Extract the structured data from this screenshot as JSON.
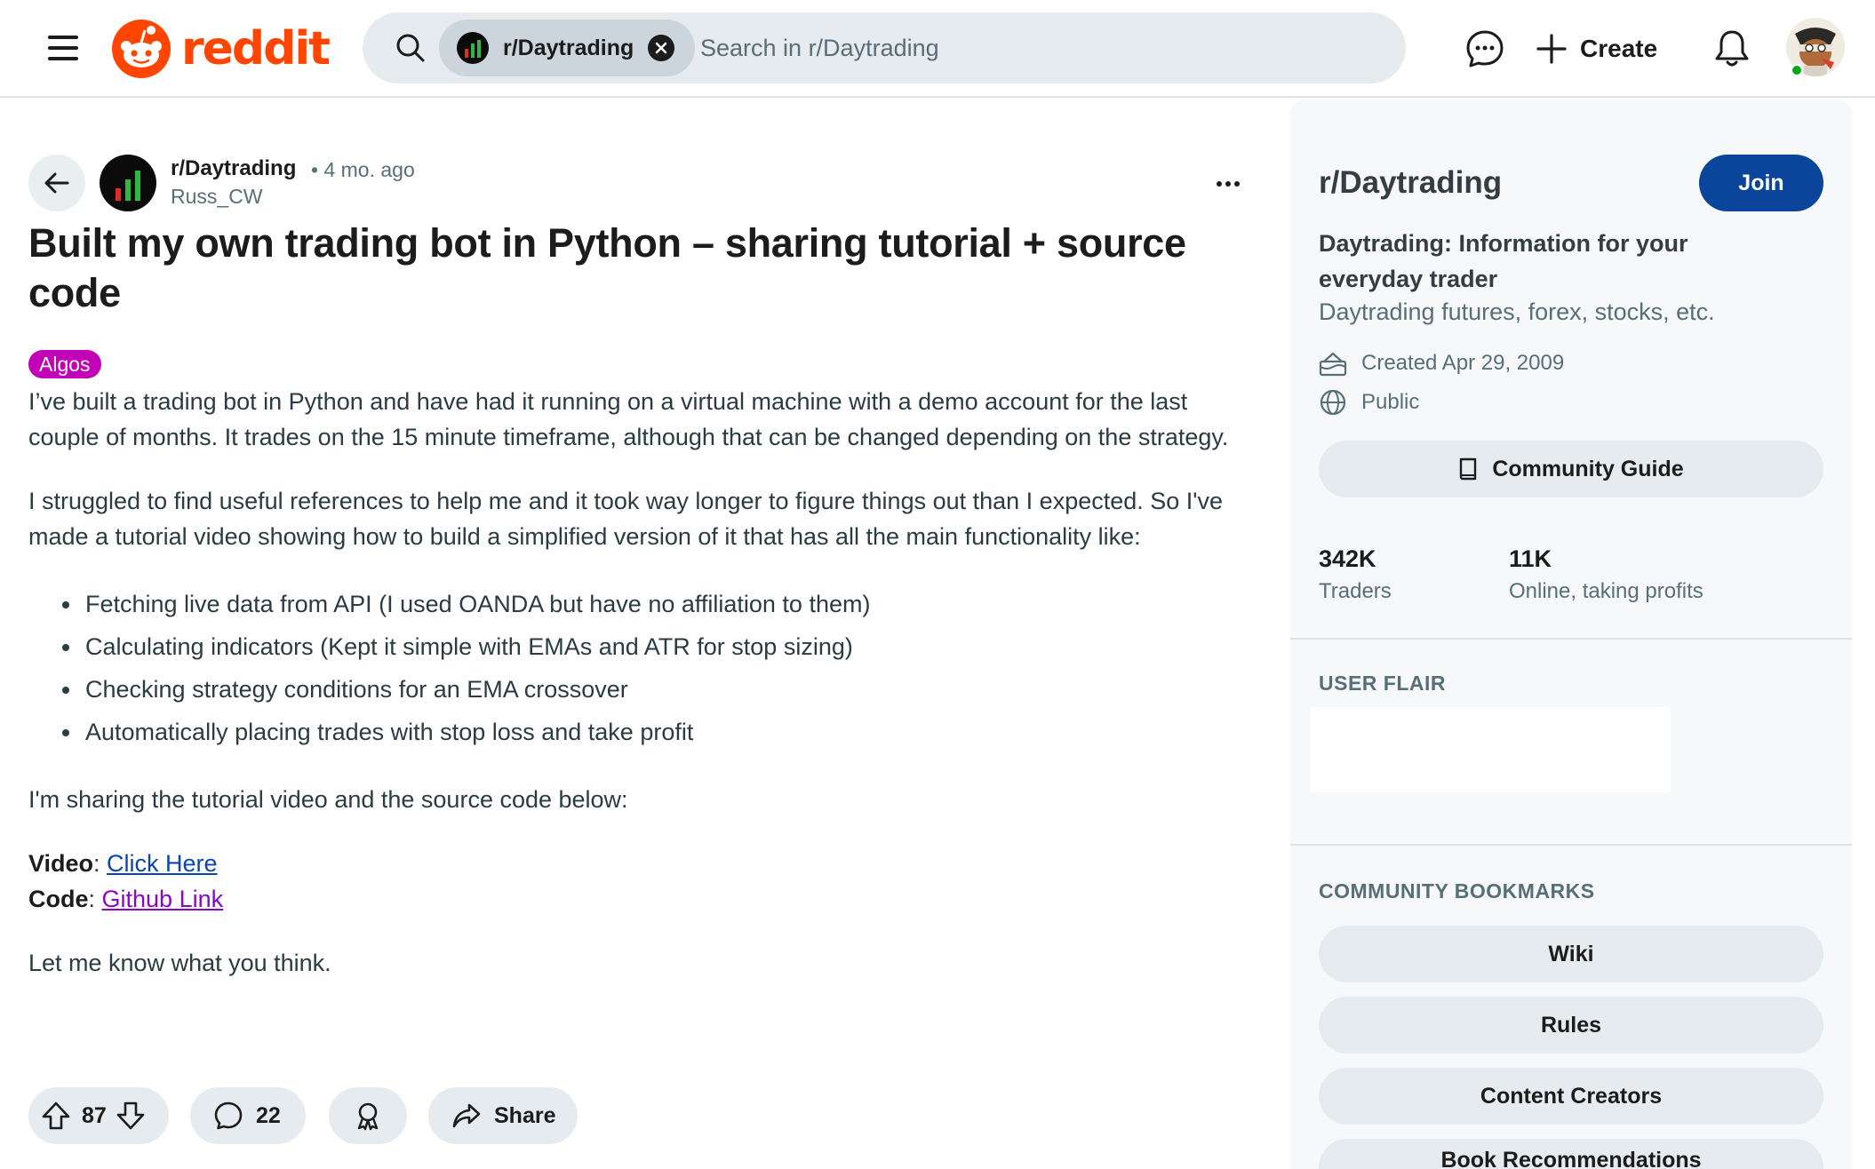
{
  "header": {
    "logo_text": "reddit",
    "search": {
      "scope_chip": "r/Daytrading",
      "placeholder": "Search in r/Daytrading"
    },
    "create_label": "Create",
    "icons": [
      "menu-icon",
      "reddit-snoo-icon",
      "search-icon",
      "close-icon",
      "chat-icon",
      "plus-icon",
      "bell-icon",
      "user-avatar"
    ]
  },
  "post": {
    "subreddit": "r/Daytrading",
    "age": "• 4 mo. ago",
    "author": "Russ_CW",
    "title": "Built my own trading bot in Python – sharing tutorial + source code",
    "flair": "Algos",
    "paragraph1": "I’ve built a trading bot in Python and have had it running on a virtual machine with a demo account for the last couple of months. It trades on the 15 minute timeframe, although that can be changed depending on the strategy.",
    "paragraph2": "I struggled to find useful references to help me and it took way longer to figure things out than I expected. So I've made a tutorial video showing how to build a simplified version of it that has all the main functionality like:",
    "bullets": [
      "Fetching live data from API (I used OANDA but have no affiliation to them)",
      "Calculating indicators (Kept it simple with EMAs and ATR for stop sizing)",
      "Checking strategy conditions for an EMA crossover",
      "Automatically placing trades with stop loss and take profit"
    ],
    "paragraph3": "I'm sharing the tutorial video and the source code below:",
    "video_label": "Video",
    "video_link": "Click Here",
    "code_label": "Code",
    "code_link": "Github Link",
    "paragraph4": "Let me know what you think.",
    "votes": "87",
    "comments": "22",
    "share_label": "Share"
  },
  "sidebar": {
    "title": "r/Daytrading",
    "join_label": "Join",
    "headline": "Daytrading: Information for your everyday trader",
    "description": "Daytrading futures, forex, stocks, etc.",
    "created": "Created Apr 29, 2009",
    "visibility": "Public",
    "guide_label": "Community Guide",
    "stats": [
      {
        "value": "342K",
        "label": "Traders"
      },
      {
        "value": "11K",
        "label": "Online, taking profits"
      }
    ],
    "user_flair_heading": "USER FLAIR",
    "bookmarks_heading": "COMMUNITY BOOKMARKS",
    "bookmarks": [
      "Wiki",
      "Rules",
      "Content Creators",
      "Book Recommendations"
    ]
  },
  "colors": {
    "brand": "#ff4500",
    "join": "#0a449b",
    "flair": "#c200b8",
    "link": "#0b44b3",
    "visited_link": "#8a06c7"
  }
}
